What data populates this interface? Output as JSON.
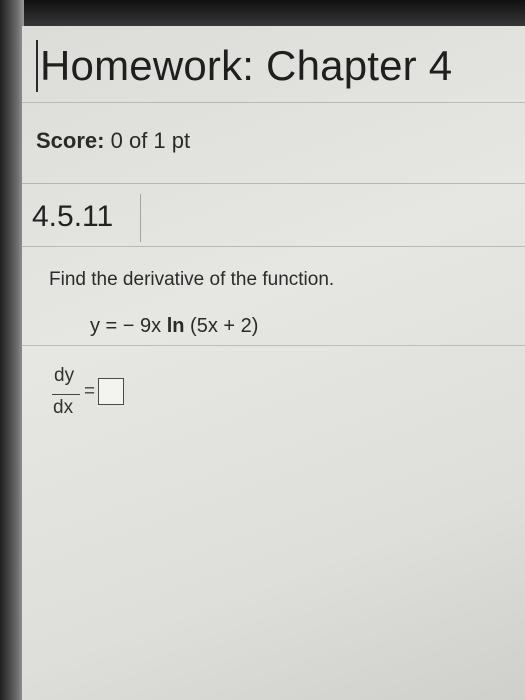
{
  "header": {
    "title": "Homework: Chapter 4"
  },
  "score": {
    "label": "Score:",
    "value": "0 of 1 pt"
  },
  "question": {
    "number": "4.5.11",
    "prompt": "Find the derivative of the function.",
    "equation": {
      "lhs": "y = − 9x ",
      "func": "ln",
      "rhs": " (5x + 2)"
    },
    "answer": {
      "numerator": "dy",
      "denominator": "dx",
      "equals": "=",
      "value": ""
    }
  }
}
